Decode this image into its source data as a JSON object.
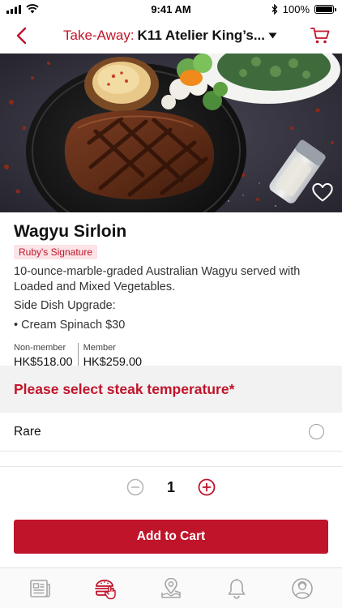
{
  "status_bar": {
    "time": "9:41 AM",
    "battery": "100%",
    "battery_level": 1.0
  },
  "nav": {
    "mode_label": "Take-Away:",
    "store_name": "K11 Atelier King’s...",
    "back_icon": "chevron-left-icon",
    "cart_icon": "cart-icon",
    "accent_color": "#c0142b"
  },
  "item": {
    "title": "Wagyu Sirloin",
    "tag": "Ruby's Signature",
    "description": "10-ounce-marble-graded Australian Wagyu served with Loaded and Mixed Vegetables.",
    "side_dish_label": "Side Dish Upgrade:",
    "side_dishes": [
      "• Cream Spinach $30"
    ],
    "prices": [
      {
        "label": "Non-member",
        "value": "HK$518.00"
      },
      {
        "label": "Member",
        "value": "HK$259.00"
      }
    ]
  },
  "temperature": {
    "heading": "Please select steak temperature*",
    "options": [
      {
        "label": "Rare",
        "selected": false
      }
    ]
  },
  "quantity": {
    "value": "1"
  },
  "add_to_cart_label": "Add to Cart",
  "tabs": [
    {
      "icon": "news-icon",
      "active": false
    },
    {
      "icon": "burger-order-icon",
      "active": true
    },
    {
      "icon": "location-pin-icon",
      "active": false
    },
    {
      "icon": "bell-icon",
      "active": false
    },
    {
      "icon": "profile-icon",
      "active": false
    }
  ],
  "colors": {
    "brand_red": "#c0142b",
    "tag_bg": "#fbe3e6",
    "section_bg": "#f2f2f2",
    "inactive_icon": "#9a9a9a"
  }
}
